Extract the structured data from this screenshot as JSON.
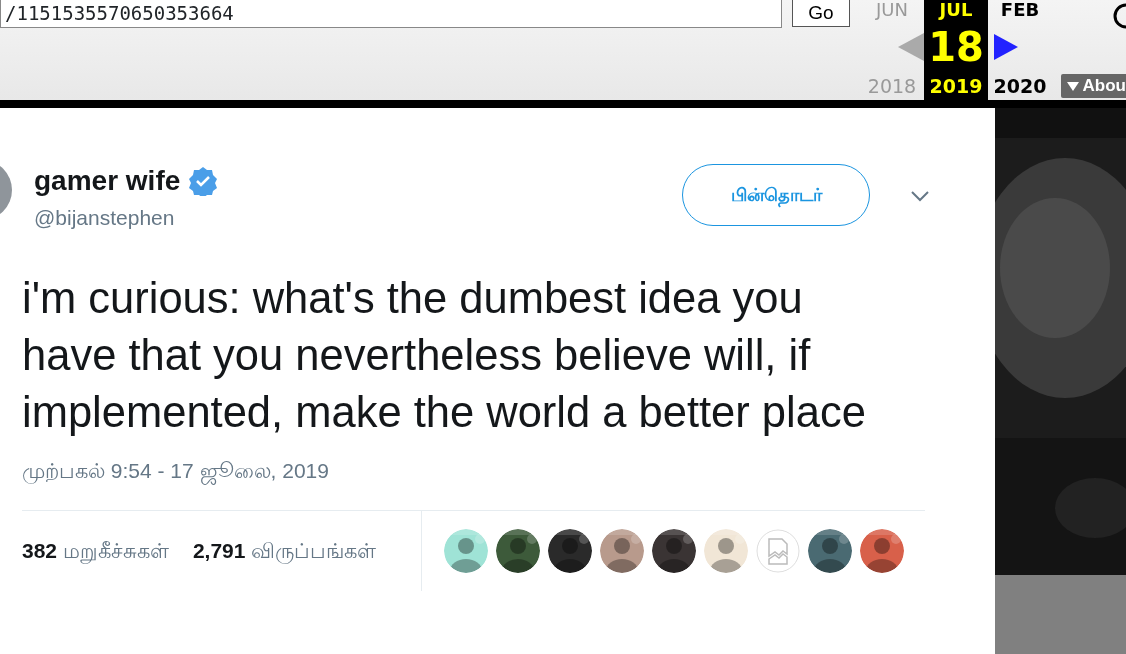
{
  "wayback": {
    "url": "/1151535570650353664",
    "go_button": "Go",
    "months": [
      {
        "month": "JUN",
        "year": "2018",
        "selected": false
      },
      {
        "month": "JUL",
        "day": "18",
        "year": "2019",
        "selected": true
      },
      {
        "month": "FEB",
        "year": "2020",
        "selected": false
      }
    ],
    "about_button": "Abou"
  },
  "tweet": {
    "name": "gamer wife",
    "verified": true,
    "handle": "@bijanstephen",
    "follow_button": "பின்தொடர்",
    "text": "i'm curious: what's the dumbest idea you have that you nevertheless believe will, if implemented, make the world a better place",
    "timestamp": "முற்பகல் 9:54 - 17 ஜூலை, 2019",
    "stats": [
      {
        "count": "382",
        "label": "மறுகீச்சுகள்"
      },
      {
        "count": "2,791",
        "label": "விருப்பங்கள்"
      }
    ],
    "likers": [
      {
        "kind": "picture",
        "color": "#9fe3d6"
      },
      {
        "kind": "picture",
        "color": "#3d5a3a"
      },
      {
        "kind": "picture",
        "color": "#2a2a2a"
      },
      {
        "kind": "picture",
        "color": "#b89a8c"
      },
      {
        "kind": "picture",
        "color": "#3a3434"
      },
      {
        "kind": "picture",
        "color": "#f1e6d6"
      },
      {
        "kind": "broken"
      },
      {
        "kind": "picture",
        "color": "#4a6a72"
      },
      {
        "kind": "picture",
        "color": "#d8604a"
      }
    ]
  }
}
